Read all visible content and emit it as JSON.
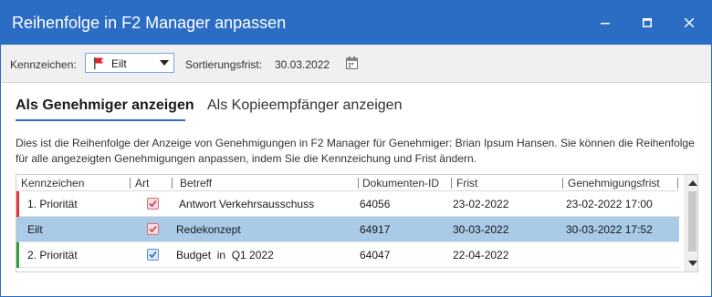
{
  "window": {
    "title": "Reihenfolge in F2 Manager anpassen",
    "accent_color": "#2b6cc4"
  },
  "toolbar": {
    "kennzeichen_label": "Kennzeichen:",
    "kennzeichen_value": "Eilt",
    "frist_label": "Sortierungsfrist:",
    "frist_value": "30.03.2022",
    "icons": [
      "red-flag-icon",
      "calendar-icon"
    ]
  },
  "tabs": [
    {
      "label": "Als Genehmiger anzeigen",
      "active": true
    },
    {
      "label": "Als Kopieempfänger anzeigen",
      "active": false
    }
  ],
  "description": "Dies ist die Reihenfolge der Anzeige von Genehmigungen in F2 Manager für Genehmiger: Brian Ipsum Hansen. Sie können die Reihenfolge für alle angezeigten Genehmigungen anpassen, indem Sie die Kennzeichung und Frist ändern.",
  "grid": {
    "columns": [
      "Kennzeichen",
      "Art",
      "Betreff",
      "Dokumenten-ID",
      "Frist",
      "Genehmigungsfrist"
    ],
    "rows": [
      {
        "kennzeichen": "1. Priorität",
        "art_icon": "approval-red-icon",
        "betreff": "Antwort Verkehrsausschuss",
        "dokumenten_id": "64056",
        "frist": "23-02-2022",
        "genehmigungsfrist": "23-02-2022 17:00",
        "marker_color": "#e0353a",
        "selected": false
      },
      {
        "kennzeichen": "Eilt",
        "art_icon": "approval-red-icon",
        "betreff": "Redekonzept",
        "dokumenten_id": "64917",
        "frist": "30-03-2022",
        "genehmigungsfrist": "30-03-2022 17:52",
        "marker_color": "#a9cbe8",
        "selected": true
      },
      {
        "kennzeichen": "2. Priorität",
        "art_icon": "approval-blue-icon",
        "betreff": "Budget  in  Q1 2022",
        "dokumenten_id": "64047",
        "frist": "22-04-2022",
        "genehmigungsfrist": "",
        "marker_color": "#2e9e3e",
        "selected": false
      }
    ],
    "selected_row_color": "#a9cbe8"
  }
}
